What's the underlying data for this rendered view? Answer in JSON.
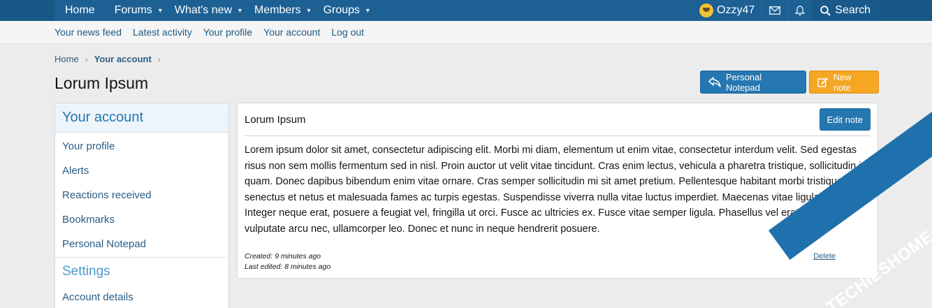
{
  "nav": {
    "items": [
      {
        "label": "Home",
        "caret": false
      },
      {
        "label": "Forums",
        "caret": true
      },
      {
        "label": "What's new",
        "caret": true
      },
      {
        "label": "Members",
        "caret": true
      },
      {
        "label": "Groups",
        "caret": true
      }
    ],
    "username": "Ozzy47",
    "search_label": "Search"
  },
  "subnav": {
    "links": [
      "Your news feed",
      "Latest activity",
      "Your profile",
      "Your account",
      "Log out"
    ]
  },
  "breadcrumb": {
    "home": "Home",
    "current": "Your account"
  },
  "page": {
    "title": "Lorum Ipsum",
    "personal_notepad_button": "Personal Notepad",
    "new_note_button": "New note"
  },
  "sidebar": {
    "heading": "Your account",
    "items": [
      "Your profile",
      "Alerts",
      "Reactions received",
      "Bookmarks",
      "Personal Notepad"
    ],
    "section2_heading": "Settings",
    "section2_items": [
      "Account details"
    ]
  },
  "note": {
    "title": "Lorum Ipsum",
    "edit_button": "Edit note",
    "body": "Lorem ipsum dolor sit amet, consectetur adipiscing elit. Morbi mi diam, elementum ut enim vitae, consectetur interdum velit. Sed egestas risus non sem mollis fermentum sed in nisl. Proin auctor ut velit vitae tincidunt. Cras enim lectus, vehicula a pharetra tristique, sollicitudin id quam. Donec dapibus bibendum enim vitae ornare. Cras semper sollicitudin mi sit amet pretium. Pellentesque habitant morbi tristique senectus et netus et malesuada fames ac turpis egestas. Suspendisse viverra nulla vitae luctus imperdiet. Maecenas vitae ligula massa. Integer neque erat, posuere a feugiat vel, fringilla ut orci. Fusce ac ultricies ex. Fusce vitae semper ligula. Phasellus vel erat tempus, vulputate arcu nec, ullamcorper leo. Donec et nunc in neque hendrerit posuere.",
    "created": "Created: 9 minutes ago",
    "last_edited": "Last edited: 8 minutes ago",
    "delete_label": "Delete"
  },
  "watermark": "TECHIESHOME.COM",
  "colors": {
    "nav_bg": "#185886",
    "accent_blue": "#2577b1",
    "new_note_orange": "#f5a623"
  }
}
